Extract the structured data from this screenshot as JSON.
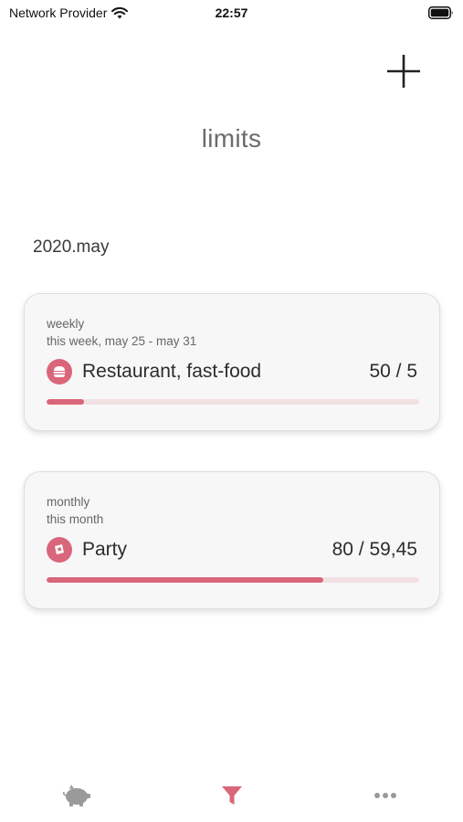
{
  "status": {
    "carrier": "Network Provider",
    "time": "22:57"
  },
  "header": {
    "title": "limits"
  },
  "period": "2020.may",
  "limits": [
    {
      "type": "weekly",
      "range": "this week, may 25 - may 31",
      "icon": "burger-icon",
      "category": "Restaurant, fast-food",
      "amount": "50 / 5",
      "progress": 0.1
    },
    {
      "type": "monthly",
      "range": "this month",
      "icon": "gift-icon",
      "category": "Party",
      "amount": "80 / 59,45",
      "progress": 0.743
    }
  ],
  "tabs": [
    {
      "name": "piggy-bank",
      "active": false
    },
    {
      "name": "filter",
      "active": true
    },
    {
      "name": "more",
      "active": false
    }
  ],
  "colors": {
    "accent": "#d9667a",
    "inactive": "#9a9a9a",
    "track": "#f2e0e3"
  }
}
